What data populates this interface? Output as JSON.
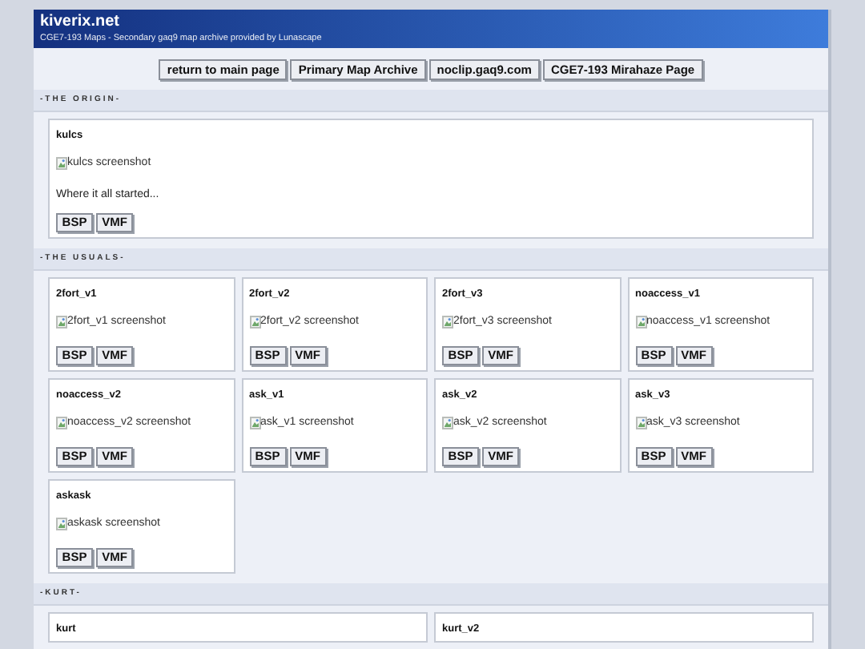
{
  "header": {
    "title": "kiverix.net",
    "subtitle": "CGE7-193 Maps - Secondary gaq9 map archive provided by Lunascape"
  },
  "nav": [
    "return to main page",
    "Primary Map Archive",
    "noclip.gaq9.com",
    "CGE7-193 Mirahaze Page"
  ],
  "sections": [
    {
      "title": "-THE ORIGIN-",
      "maps": [
        {
          "name": "kulcs",
          "alt": "kulcs screenshot",
          "description": "Where it all started...",
          "buttons": [
            "BSP",
            "VMF"
          ]
        }
      ]
    },
    {
      "title": "-THE USUALS-",
      "maps": [
        {
          "name": "2fort_v1",
          "alt": "2fort_v1 screenshot",
          "buttons": [
            "BSP",
            "VMF"
          ]
        },
        {
          "name": "2fort_v2",
          "alt": "2fort_v2 screenshot",
          "buttons": [
            "BSP",
            "VMF"
          ]
        },
        {
          "name": "2fort_v3",
          "alt": "2fort_v3 screenshot",
          "buttons": [
            "BSP",
            "VMF"
          ]
        },
        {
          "name": "noaccess_v1",
          "alt": "noaccess_v1 screenshot",
          "buttons": [
            "BSP",
            "VMF"
          ]
        },
        {
          "name": "noaccess_v2",
          "alt": "noaccess_v2 screenshot",
          "buttons": [
            "BSP",
            "VMF"
          ]
        },
        {
          "name": "ask_v1",
          "alt": "ask_v1 screenshot",
          "buttons": [
            "BSP",
            "VMF"
          ]
        },
        {
          "name": "ask_v2",
          "alt": "ask_v2 screenshot",
          "buttons": [
            "BSP",
            "VMF"
          ]
        },
        {
          "name": "ask_v3",
          "alt": "ask_v3 screenshot",
          "buttons": [
            "BSP",
            "VMF"
          ]
        },
        {
          "name": "askask",
          "alt": "askask screenshot",
          "buttons": [
            "BSP",
            "VMF"
          ]
        }
      ]
    },
    {
      "title": "-KURT-",
      "maps": [
        {
          "name": "kurt"
        },
        {
          "name": "kurt_v2"
        }
      ]
    }
  ]
}
